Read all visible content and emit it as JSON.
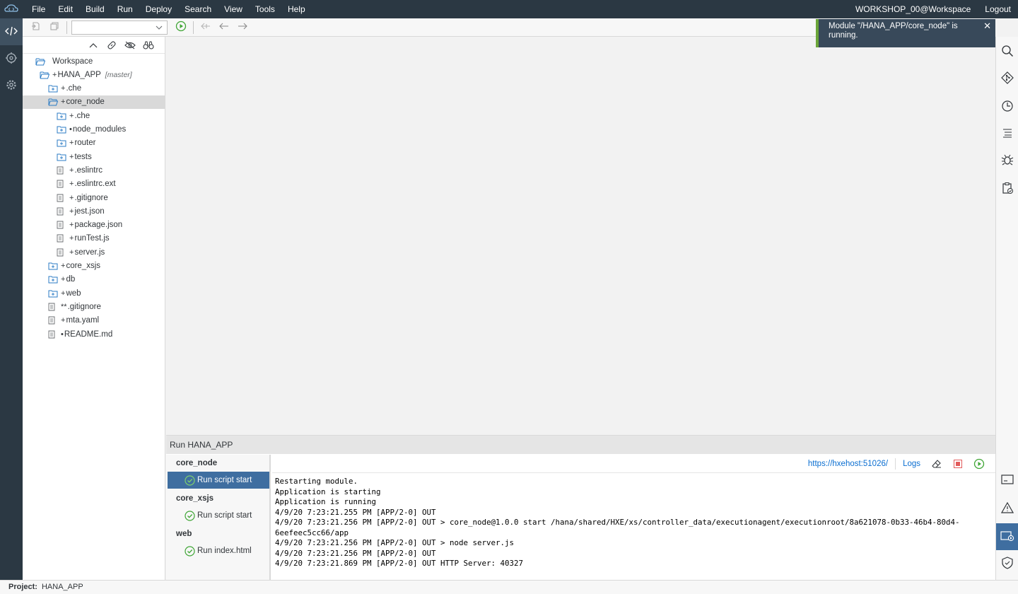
{
  "menubar": {
    "items": [
      "File",
      "Edit",
      "Build",
      "Run",
      "Deploy",
      "Search",
      "View",
      "Tools",
      "Help"
    ],
    "user": "WORKSHOP_00@Workspace",
    "logout": "Logout"
  },
  "toolbar": {
    "run_config_select": ""
  },
  "notification": {
    "message": "Module \"/HANA_APP/core_node\" is running.",
    "accent_color": "#6ba539"
  },
  "workspace": {
    "tree": [
      {
        "label": "Workspace",
        "mark": "",
        "kind": "open-folder",
        "level": 0
      },
      {
        "label": "HANA_APP",
        "mark": "+",
        "branch": "[master]",
        "kind": "open-folder",
        "level": 1
      },
      {
        "label": ".che",
        "mark": "+",
        "kind": "folder",
        "level": 2
      },
      {
        "label": "core_node",
        "mark": "+",
        "kind": "open-folder",
        "level": 2,
        "selected": true
      },
      {
        "label": ".che",
        "mark": "+",
        "kind": "folder",
        "level": 3
      },
      {
        "label": "node_modules",
        "mark": "•",
        "kind": "folder",
        "level": 3
      },
      {
        "label": "router",
        "mark": "+",
        "kind": "folder",
        "level": 3
      },
      {
        "label": "tests",
        "mark": "+",
        "kind": "folder",
        "level": 3
      },
      {
        "label": ".eslintrc",
        "mark": "+",
        "kind": "file",
        "level": 3
      },
      {
        "label": ".eslintrc.ext",
        "mark": "+",
        "kind": "file",
        "level": 3
      },
      {
        "label": ".gitignore",
        "mark": "+",
        "kind": "file",
        "level": 3
      },
      {
        "label": "jest.json",
        "mark": "+",
        "kind": "file",
        "level": 3
      },
      {
        "label": "package.json",
        "mark": "+",
        "kind": "file",
        "level": 3
      },
      {
        "label": "runTest.js",
        "mark": "+",
        "kind": "file",
        "level": 3
      },
      {
        "label": "server.js",
        "mark": "+",
        "kind": "file",
        "level": 3
      },
      {
        "label": "core_xsjs",
        "mark": "+",
        "kind": "folder",
        "level": 2
      },
      {
        "label": "db",
        "mark": "+",
        "kind": "folder",
        "level": 2
      },
      {
        "label": "web",
        "mark": "+",
        "kind": "folder",
        "level": 2
      },
      {
        "label": ".gitignore",
        "mark": "**",
        "kind": "file",
        "level": 2
      },
      {
        "label": "mta.yaml",
        "mark": "+",
        "kind": "file",
        "level": 2
      },
      {
        "label": "README.md",
        "mark": "•",
        "kind": "file",
        "level": 2
      }
    ]
  },
  "run_panel": {
    "title": "Run HANA_APP",
    "groups": [
      {
        "name": "core_node",
        "config": "Run script start",
        "active": true
      },
      {
        "name": "core_xsjs",
        "config": "Run script start",
        "active": false
      },
      {
        "name": "web",
        "config": "Run index.html",
        "active": false
      }
    ],
    "url": "https://hxehost:51026/",
    "logs": "Logs",
    "console_lines": [
      "Restarting module.",
      "Application is starting",
      "Application is running",
      "4/9/20 7:23:21.255 PM [APP/2-0] OUT",
      "4/9/20 7:23:21.256 PM [APP/2-0] OUT > core_node@1.0.0 start /hana/shared/HXE/xs/controller_data/executionagent/executionroot/8a621078-0b33-46b4-80d4-",
      "6eefeec5cc66/app",
      "4/9/20 7:23:21.256 PM [APP/2-0] OUT > node server.js",
      "4/9/20 7:23:21.256 PM [APP/2-0] OUT",
      "4/9/20 7:23:21.869 PM [APP/2-0] OUT HTTP Server: 40327"
    ]
  },
  "statusbar": {
    "label": "Project:",
    "value": "HANA_APP"
  },
  "icons": {
    "left_rail": [
      "code-icon",
      "modules-icon",
      "gear-icon"
    ],
    "right_rail": [
      "search-icon",
      "git-icon",
      "history-icon",
      "outline-icon",
      "debugger-icon",
      "clipboard-check-icon",
      "console-icon",
      "warning-icon",
      "run-console-icon",
      "shield-icon"
    ]
  }
}
